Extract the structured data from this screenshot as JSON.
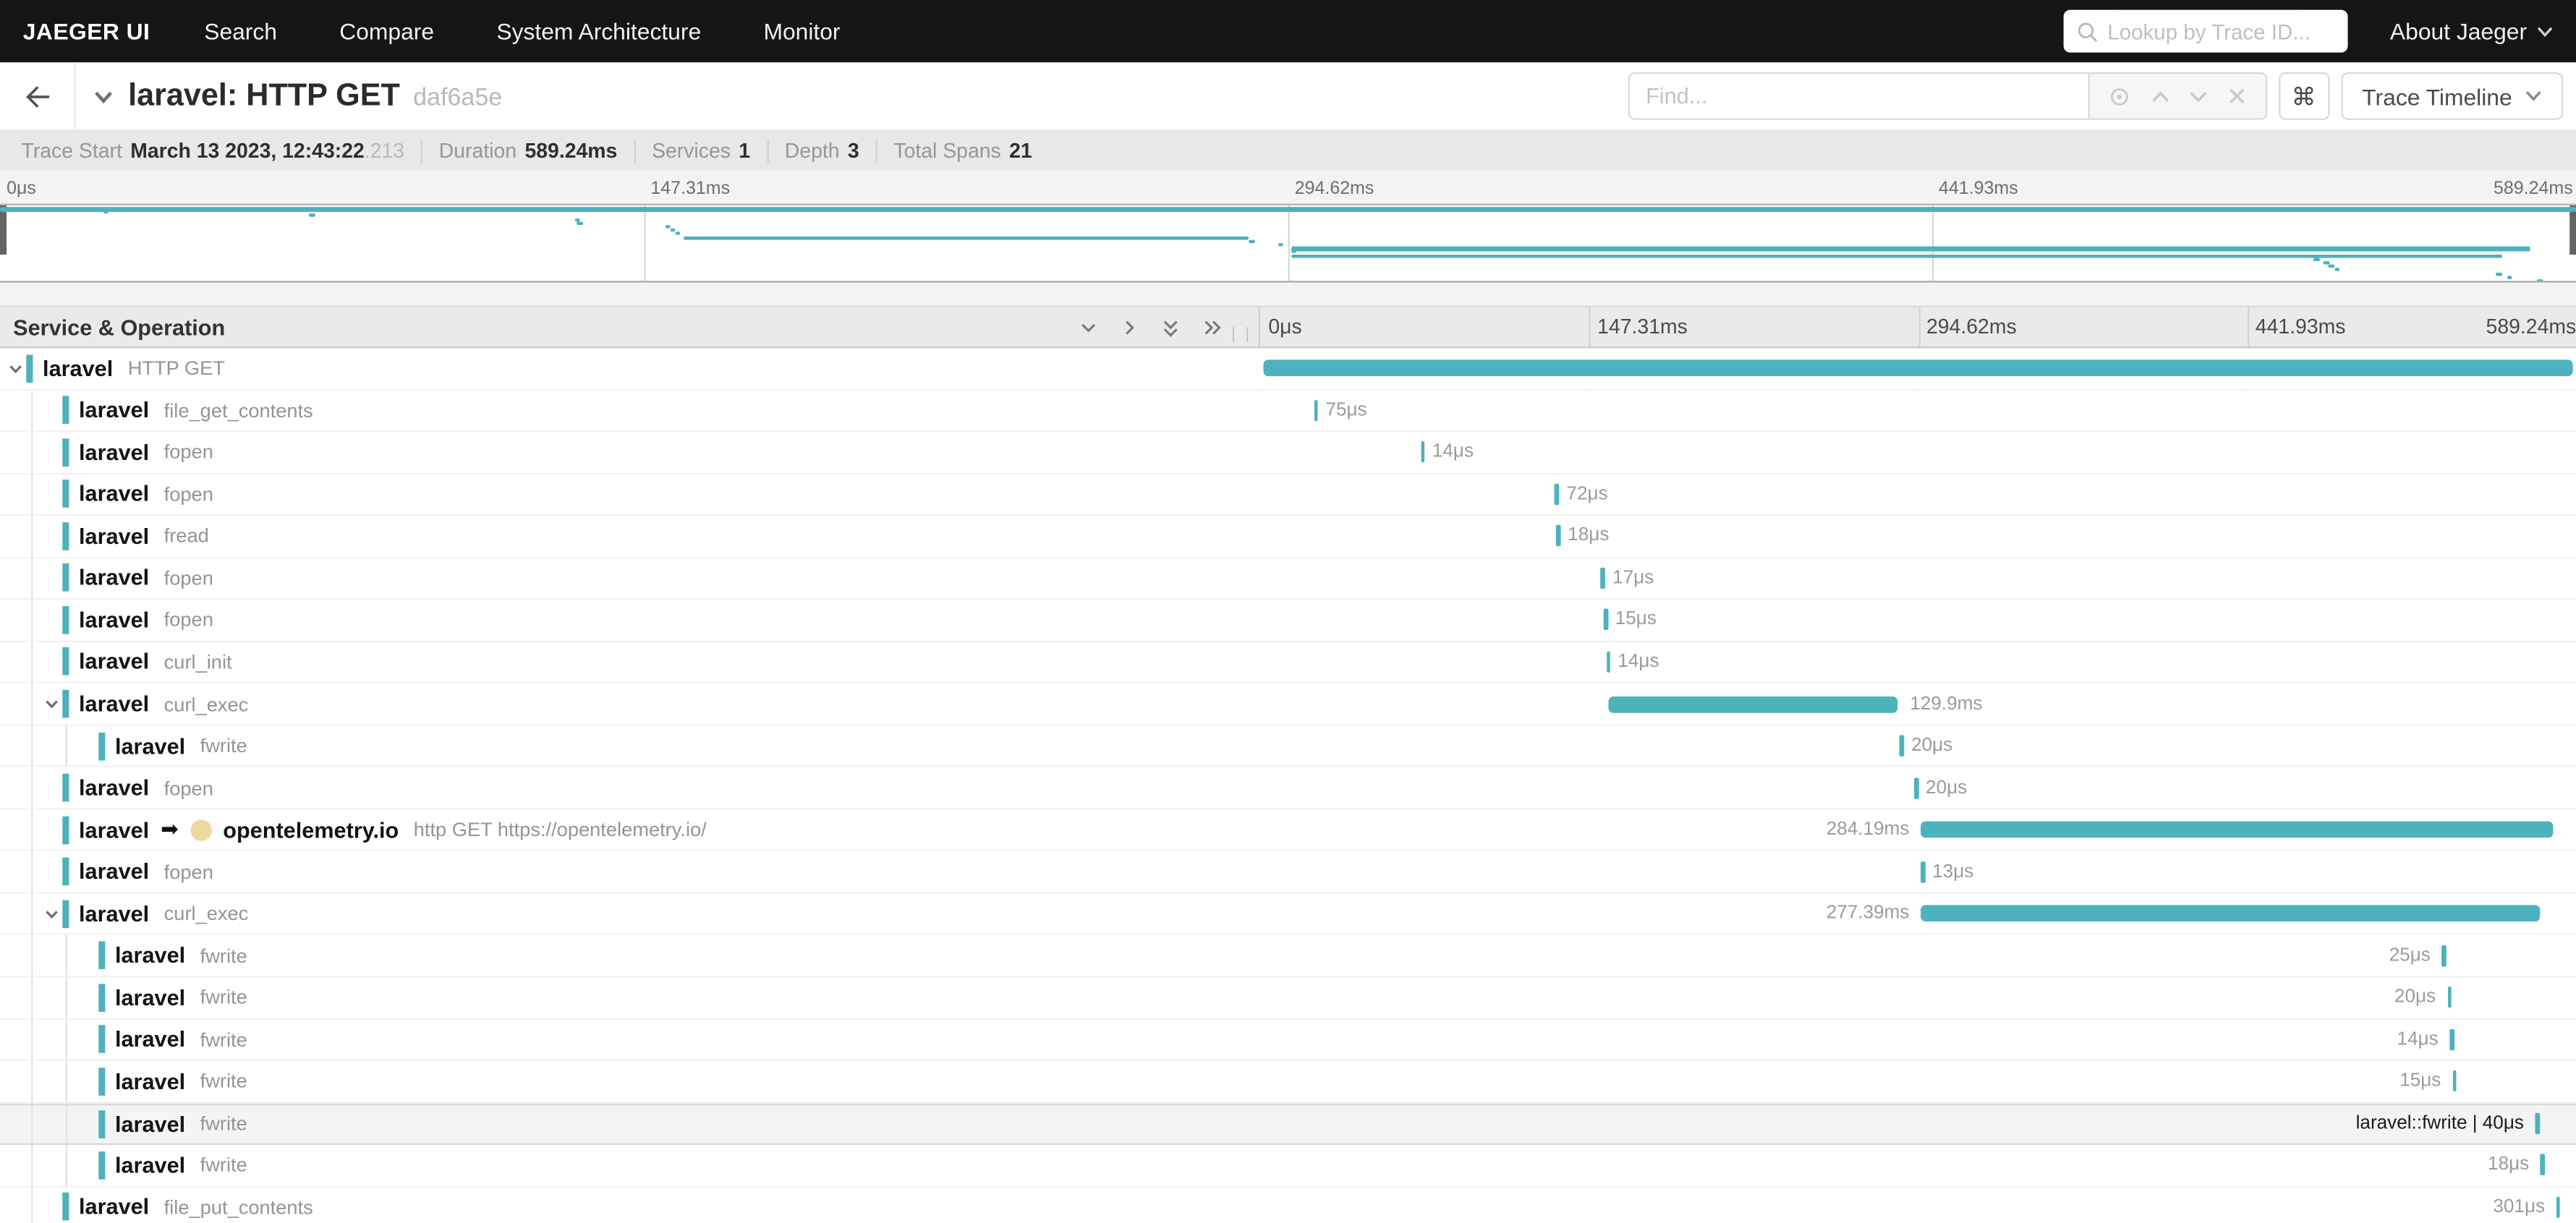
{
  "nav": {
    "brand": "JAEGER UI",
    "items": [
      "Search",
      "Compare",
      "System Architecture",
      "Monitor"
    ],
    "lookup_placeholder": "Lookup by Trace ID...",
    "about_label": "About Jaeger"
  },
  "trace_header": {
    "title": "laravel: HTTP GET",
    "trace_id_short": "daf6a5e",
    "find_placeholder": "Find...",
    "view_selector_label": "Trace Timeline",
    "kbd_shortcut_icon": "command-icon"
  },
  "summary": {
    "trace_start_label": "Trace Start",
    "trace_start_value": "March 13 2023, 12:43:22",
    "trace_start_fraction": ".213",
    "duration_label": "Duration",
    "duration_value": "589.24ms",
    "services_label": "Services",
    "services_value": "1",
    "depth_label": "Depth",
    "depth_value": "3",
    "total_spans_label": "Total Spans",
    "total_spans_value": "21"
  },
  "timeline": {
    "column_header": "Service & Operation",
    "ticks": [
      "0μs",
      "147.31ms",
      "294.62ms",
      "441.93ms",
      "589.24ms"
    ],
    "accent_color": "#4db2bd"
  },
  "rows": [
    {
      "service": "laravel",
      "operation": "HTTP GET",
      "depth": 0,
      "expandable": true,
      "bar": {
        "type": "bar",
        "left": 0.2,
        "width": 99.6,
        "label": "",
        "side": "none"
      }
    },
    {
      "service": "laravel",
      "operation": "file_get_contents",
      "depth": 1,
      "bar": {
        "type": "tick",
        "left": 4.1,
        "label": "75μs",
        "side": "right"
      }
    },
    {
      "service": "laravel",
      "operation": "fopen",
      "depth": 1,
      "bar": {
        "type": "tick",
        "left": 12.2,
        "label": "14μs",
        "side": "right"
      }
    },
    {
      "service": "laravel",
      "operation": "fopen",
      "depth": 1,
      "bar": {
        "type": "tick",
        "left": 22.4,
        "label": "72μs",
        "side": "right"
      }
    },
    {
      "service": "laravel",
      "operation": "fread",
      "depth": 1,
      "bar": {
        "type": "tick",
        "left": 22.5,
        "label": "18μs",
        "side": "right"
      }
    },
    {
      "service": "laravel",
      "operation": "fopen",
      "depth": 1,
      "bar": {
        "type": "tick",
        "left": 25.9,
        "label": "17μs",
        "side": "right"
      }
    },
    {
      "service": "laravel",
      "operation": "fopen",
      "depth": 1,
      "bar": {
        "type": "tick",
        "left": 26.1,
        "label": "15μs",
        "side": "right"
      }
    },
    {
      "service": "laravel",
      "operation": "curl_init",
      "depth": 1,
      "bar": {
        "type": "tick",
        "left": 26.3,
        "label": "14μs",
        "side": "right"
      }
    },
    {
      "service": "laravel",
      "operation": "curl_exec",
      "depth": 1,
      "expandable": true,
      "bar": {
        "type": "bar",
        "left": 26.5,
        "width": 22.0,
        "label": "129.9ms",
        "side": "right"
      }
    },
    {
      "service": "laravel",
      "operation": "fwrite",
      "depth": 2,
      "bar": {
        "type": "tick",
        "left": 48.6,
        "label": "20μs",
        "side": "right"
      }
    },
    {
      "service": "laravel",
      "operation": "fopen",
      "depth": 1,
      "bar": {
        "type": "tick",
        "left": 49.7,
        "label": "20μs",
        "side": "right"
      }
    },
    {
      "service": "laravel",
      "operation": "http GET https://opentelemetry.io/",
      "depth": 1,
      "remote": true,
      "peer_service": "opentelemetry.io",
      "bar": {
        "type": "bar",
        "left": 50.2,
        "width": 48.1,
        "label": "284.19ms",
        "side": "left"
      }
    },
    {
      "service": "laravel",
      "operation": "fopen",
      "depth": 1,
      "bar": {
        "type": "tick",
        "left": 50.2,
        "label": "13μs",
        "side": "right"
      }
    },
    {
      "service": "laravel",
      "operation": "curl_exec",
      "depth": 1,
      "expandable": true,
      "bar": {
        "type": "bar",
        "left": 50.2,
        "width": 47.0,
        "label": "277.39ms",
        "side": "left"
      }
    },
    {
      "service": "laravel",
      "operation": "fwrite",
      "depth": 2,
      "bar": {
        "type": "tick",
        "left": 89.8,
        "label": "25μs",
        "side": "left"
      }
    },
    {
      "service": "laravel",
      "operation": "fwrite",
      "depth": 2,
      "bar": {
        "type": "tick",
        "left": 90.2,
        "label": "20μs",
        "side": "left"
      }
    },
    {
      "service": "laravel",
      "operation": "fwrite",
      "depth": 2,
      "bar": {
        "type": "tick",
        "left": 90.4,
        "label": "14μs",
        "side": "left"
      }
    },
    {
      "service": "laravel",
      "operation": "fwrite",
      "depth": 2,
      "bar": {
        "type": "tick",
        "left": 90.6,
        "label": "15μs",
        "side": "left"
      }
    },
    {
      "service": "laravel",
      "operation": "fwrite",
      "depth": 2,
      "hovered": true,
      "bar": {
        "type": "tick",
        "left": 96.9,
        "label": "laravel::fwrite | 40μs",
        "side": "left",
        "label_dark": true
      }
    },
    {
      "service": "laravel",
      "operation": "fwrite",
      "depth": 2,
      "bar": {
        "type": "tick",
        "left": 97.3,
        "label": "18μs",
        "side": "left"
      }
    },
    {
      "service": "laravel",
      "operation": "file_put_contents",
      "depth": 1,
      "bar": {
        "type": "tick",
        "left": 98.5,
        "label": "301μs",
        "side": "left"
      }
    }
  ],
  "minimap": {
    "spans": [
      {
        "l": 0,
        "w": 100,
        "t": 1,
        "h": 3
      },
      {
        "l": 4.0,
        "t": 3.2
      },
      {
        "l": 12.0,
        "t": 5.4
      },
      {
        "l": 22.3,
        "t": 7.6
      },
      {
        "l": 22.4,
        "t": 9.8
      },
      {
        "l": 25.8,
        "t": 12
      },
      {
        "l": 26.0,
        "t": 14.2
      },
      {
        "l": 26.2,
        "t": 16.4
      },
      {
        "l": 26.5,
        "w": 22.0,
        "t": 18.6,
        "h": 2.5
      },
      {
        "l": 48.5,
        "t": 20.8
      },
      {
        "l": 49.6,
        "t": 23
      },
      {
        "l": 50.1,
        "w": 48.1,
        "t": 25.2,
        "h": 2.5
      },
      {
        "l": 50.1,
        "t": 27.4
      },
      {
        "l": 50.1,
        "w": 47.0,
        "t": 29.6,
        "h": 2.5
      },
      {
        "l": 89.8,
        "t": 31.8
      },
      {
        "l": 90.2,
        "t": 34
      },
      {
        "l": 90.4,
        "t": 36.2
      },
      {
        "l": 90.6,
        "t": 38.4
      },
      {
        "l": 96.9,
        "t": 40.6
      },
      {
        "l": 97.3,
        "t": 42.8
      },
      {
        "l": 98.5,
        "t": 45
      }
    ]
  }
}
